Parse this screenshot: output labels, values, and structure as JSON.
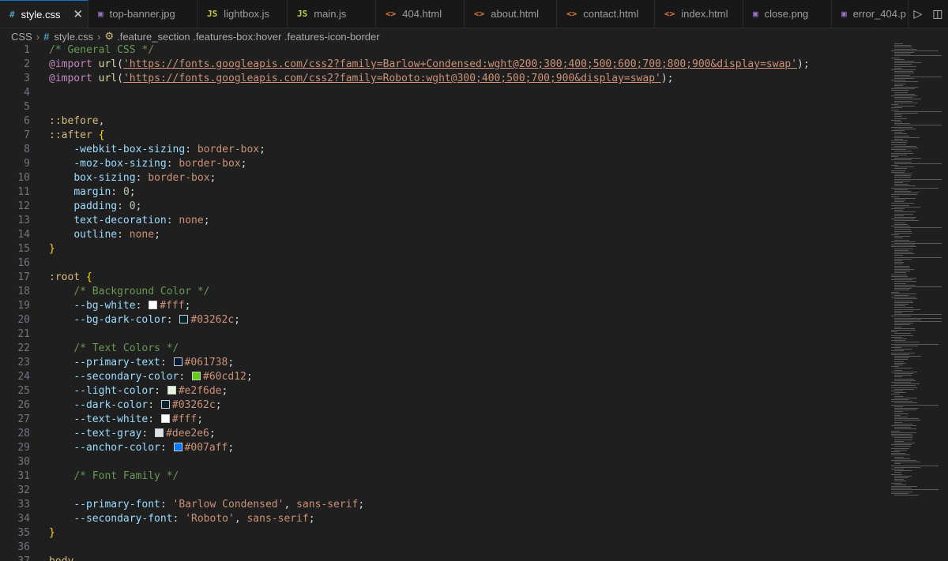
{
  "tabs": [
    {
      "label": "style.css",
      "icon": "css-file-icon",
      "glyph": "#",
      "color": "#519aba",
      "active": true,
      "width": 112
    },
    {
      "label": "top-banner.jpg",
      "icon": "image-file-icon",
      "glyph": "▣",
      "color": "#a074c4",
      "width": 138
    },
    {
      "label": "lightbox.js",
      "icon": "js-file-icon",
      "glyph": "JS",
      "color": "#cbcb41",
      "width": 114
    },
    {
      "label": "main.js",
      "icon": "js-file-icon",
      "glyph": "JS",
      "color": "#cbcb41",
      "width": 112
    },
    {
      "label": "404.html",
      "icon": "html-file-icon",
      "glyph": "<>",
      "color": "#e37933",
      "width": 112
    },
    {
      "label": "about.html",
      "icon": "html-file-icon",
      "glyph": "<>",
      "color": "#e37933",
      "width": 117
    },
    {
      "label": "contact.html",
      "icon": "html-file-icon",
      "glyph": "<>",
      "color": "#e37933",
      "width": 124
    },
    {
      "label": "index.html",
      "icon": "html-file-icon",
      "glyph": "<>",
      "color": "#e37933",
      "width": 112
    },
    {
      "label": "close.png",
      "icon": "image-file-icon",
      "glyph": "▣",
      "color": "#a074c4",
      "width": 112
    },
    {
      "label": "error_404.p",
      "icon": "image-file-icon",
      "glyph": "▣",
      "color": "#a074c4",
      "width": 97
    }
  ],
  "tab_actions": [
    {
      "name": "run-icon",
      "glyph": "▷"
    },
    {
      "name": "split-editor-icon",
      "glyph": "◫"
    }
  ],
  "breadcrumb": {
    "lang": "CSS",
    "file": "style.css",
    "symbol": ".feature_section .features-box:hover .features-icon-border"
  },
  "lines": [
    {
      "n": "1",
      "t": [
        [
          "c-comment",
          "/* General CSS */"
        ]
      ]
    },
    {
      "n": "2",
      "t": [
        [
          "c-at",
          "@import"
        ],
        [
          "c-punc",
          " "
        ],
        [
          "c-fn",
          "url"
        ],
        [
          "c-punc",
          "("
        ],
        [
          "c-url",
          "'https://fonts.googleapis.com/css2?family=Barlow+Condensed:wght@200;300;400;500;600;700;800;900&display=swap'"
        ],
        [
          "c-punc",
          ");"
        ]
      ]
    },
    {
      "n": "3",
      "t": [
        [
          "c-at",
          "@import"
        ],
        [
          "c-punc",
          " "
        ],
        [
          "c-fn",
          "url"
        ],
        [
          "c-punc",
          "("
        ],
        [
          "c-url",
          "'https://fonts.googleapis.com/css2?family=Roboto:wght@300;400;500;700;900&display=swap'"
        ],
        [
          "c-punc",
          ");"
        ]
      ]
    },
    {
      "n": "4",
      "t": []
    },
    {
      "n": "5",
      "t": []
    },
    {
      "n": "6",
      "t": [
        [
          "c-sel",
          "::before"
        ],
        [
          "c-punc",
          ","
        ]
      ]
    },
    {
      "n": "7",
      "t": [
        [
          "c-sel",
          "::after"
        ],
        [
          "c-punc",
          " "
        ],
        [
          "c-brace",
          "{"
        ]
      ]
    },
    {
      "n": "8",
      "t": [
        [
          "c-punc",
          "    "
        ],
        [
          "c-prop",
          "-webkit-box-sizing"
        ],
        [
          "c-punc",
          ": "
        ],
        [
          "c-val",
          "border-box"
        ],
        [
          "c-punc",
          ";"
        ]
      ]
    },
    {
      "n": "9",
      "t": [
        [
          "c-punc",
          "    "
        ],
        [
          "c-prop",
          "-moz-box-sizing"
        ],
        [
          "c-punc",
          ": "
        ],
        [
          "c-val",
          "border-box"
        ],
        [
          "c-punc",
          ";"
        ]
      ]
    },
    {
      "n": "10",
      "t": [
        [
          "c-punc",
          "    "
        ],
        [
          "c-prop",
          "box-sizing"
        ],
        [
          "c-punc",
          ": "
        ],
        [
          "c-val",
          "border-box"
        ],
        [
          "c-punc",
          ";"
        ]
      ]
    },
    {
      "n": "11",
      "t": [
        [
          "c-punc",
          "    "
        ],
        [
          "c-prop",
          "margin"
        ],
        [
          "c-punc",
          ": "
        ],
        [
          "c-num",
          "0"
        ],
        [
          "c-punc",
          ";"
        ]
      ]
    },
    {
      "n": "12",
      "t": [
        [
          "c-punc",
          "    "
        ],
        [
          "c-prop",
          "padding"
        ],
        [
          "c-punc",
          ": "
        ],
        [
          "c-num",
          "0"
        ],
        [
          "c-punc",
          ";"
        ]
      ]
    },
    {
      "n": "13",
      "t": [
        [
          "c-punc",
          "    "
        ],
        [
          "c-prop",
          "text-decoration"
        ],
        [
          "c-punc",
          ": "
        ],
        [
          "c-val",
          "none"
        ],
        [
          "c-punc",
          ";"
        ]
      ]
    },
    {
      "n": "14",
      "t": [
        [
          "c-punc",
          "    "
        ],
        [
          "c-prop",
          "outline"
        ],
        [
          "c-punc",
          ": "
        ],
        [
          "c-val",
          "none"
        ],
        [
          "c-punc",
          ";"
        ]
      ]
    },
    {
      "n": "15",
      "t": [
        [
          "c-brace",
          "}"
        ]
      ]
    },
    {
      "n": "16",
      "t": []
    },
    {
      "n": "17",
      "t": [
        [
          "c-sel",
          ":root"
        ],
        [
          "c-punc",
          " "
        ],
        [
          "c-brace",
          "{"
        ]
      ]
    },
    {
      "n": "18",
      "t": [
        [
          "c-punc",
          "    "
        ],
        [
          "c-comment",
          "/* Background Color */"
        ]
      ]
    },
    {
      "n": "19",
      "t": [
        [
          "c-punc",
          "    "
        ],
        [
          "c-prop",
          "--bg-white"
        ],
        [
          "c-punc",
          ": "
        ],
        [
          "swatch",
          "#ffffff"
        ],
        [
          "c-val",
          "#fff"
        ],
        [
          "c-punc",
          ";"
        ]
      ]
    },
    {
      "n": "20",
      "t": [
        [
          "c-punc",
          "    "
        ],
        [
          "c-prop",
          "--bg-dark-color"
        ],
        [
          "c-punc",
          ": "
        ],
        [
          "swatch",
          "#03262c"
        ],
        [
          "c-val",
          "#03262c"
        ],
        [
          "c-punc",
          ";"
        ]
      ]
    },
    {
      "n": "21",
      "t": []
    },
    {
      "n": "22",
      "t": [
        [
          "c-punc",
          "    "
        ],
        [
          "c-comment",
          "/* Text Colors */"
        ]
      ]
    },
    {
      "n": "23",
      "t": [
        [
          "c-punc",
          "    "
        ],
        [
          "c-prop",
          "--primary-text"
        ],
        [
          "c-punc",
          ": "
        ],
        [
          "swatch",
          "#061738"
        ],
        [
          "c-val",
          "#061738"
        ],
        [
          "c-punc",
          ";"
        ]
      ]
    },
    {
      "n": "24",
      "t": [
        [
          "c-punc",
          "    "
        ],
        [
          "c-prop",
          "--secondary-color"
        ],
        [
          "c-punc",
          ": "
        ],
        [
          "swatch",
          "#60cd12"
        ],
        [
          "c-val",
          "#60cd12"
        ],
        [
          "c-punc",
          ";"
        ]
      ]
    },
    {
      "n": "25",
      "t": [
        [
          "c-punc",
          "    "
        ],
        [
          "c-prop",
          "--light-color"
        ],
        [
          "c-punc",
          ": "
        ],
        [
          "swatch",
          "#e2f6de"
        ],
        [
          "c-val",
          "#e2f6de"
        ],
        [
          "c-punc",
          ";"
        ]
      ]
    },
    {
      "n": "26",
      "t": [
        [
          "c-punc",
          "    "
        ],
        [
          "c-prop",
          "--dark-color"
        ],
        [
          "c-punc",
          ": "
        ],
        [
          "swatch",
          "#03262c"
        ],
        [
          "c-val",
          "#03262c"
        ],
        [
          "c-punc",
          ";"
        ]
      ]
    },
    {
      "n": "27",
      "t": [
        [
          "c-punc",
          "    "
        ],
        [
          "c-prop",
          "--text-white"
        ],
        [
          "c-punc",
          ": "
        ],
        [
          "swatch",
          "#ffffff"
        ],
        [
          "c-val",
          "#fff"
        ],
        [
          "c-punc",
          ";"
        ]
      ]
    },
    {
      "n": "28",
      "t": [
        [
          "c-punc",
          "    "
        ],
        [
          "c-prop",
          "--text-gray"
        ],
        [
          "c-punc",
          ": "
        ],
        [
          "swatch",
          "#dee2e6"
        ],
        [
          "c-val",
          "#dee2e6"
        ],
        [
          "c-punc",
          ";"
        ]
      ]
    },
    {
      "n": "29",
      "t": [
        [
          "c-punc",
          "    "
        ],
        [
          "c-prop",
          "--anchor-color"
        ],
        [
          "c-punc",
          ": "
        ],
        [
          "swatch",
          "#007aff"
        ],
        [
          "c-val",
          "#007aff"
        ],
        [
          "c-punc",
          ";"
        ]
      ]
    },
    {
      "n": "30",
      "t": []
    },
    {
      "n": "31",
      "t": [
        [
          "c-punc",
          "    "
        ],
        [
          "c-comment",
          "/* Font Family */"
        ]
      ]
    },
    {
      "n": "32",
      "t": []
    },
    {
      "n": "33",
      "t": [
        [
          "c-punc",
          "    "
        ],
        [
          "c-prop",
          "--primary-font"
        ],
        [
          "c-punc",
          ": "
        ],
        [
          "c-str",
          "'Barlow Condensed'"
        ],
        [
          "c-punc",
          ", "
        ],
        [
          "c-val",
          "sans-serif"
        ],
        [
          "c-punc",
          ";"
        ]
      ]
    },
    {
      "n": "34",
      "t": [
        [
          "c-punc",
          "    "
        ],
        [
          "c-prop",
          "--secondary-font"
        ],
        [
          "c-punc",
          ": "
        ],
        [
          "c-str",
          "'Roboto'"
        ],
        [
          "c-punc",
          ", "
        ],
        [
          "c-val",
          "sans-serif"
        ],
        [
          "c-punc",
          ";"
        ]
      ]
    },
    {
      "n": "35",
      "t": [
        [
          "c-brace",
          "}"
        ]
      ]
    },
    {
      "n": "36",
      "t": []
    },
    {
      "n": "37",
      "t": [
        [
          "c-sel",
          "body"
        ],
        [
          "c-punc",
          ","
        ]
      ]
    }
  ]
}
